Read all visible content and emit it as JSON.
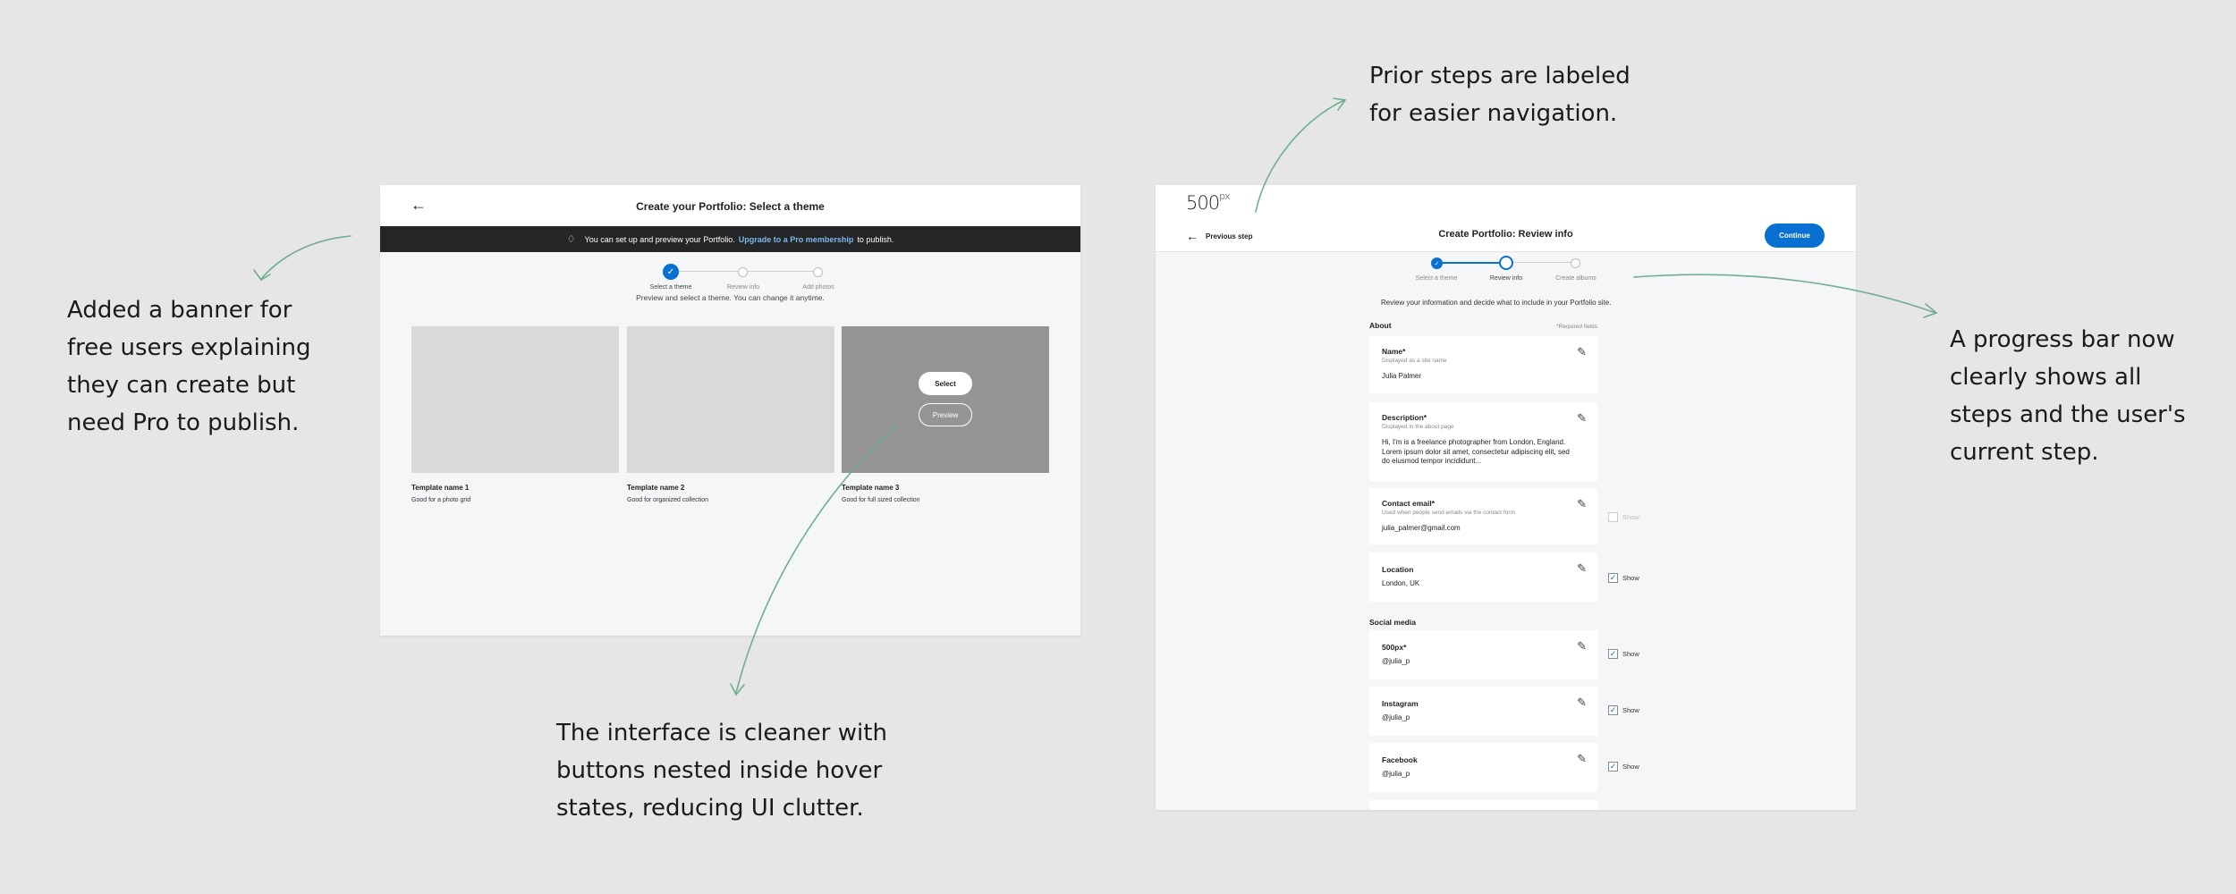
{
  "annotations": {
    "banner": [
      "Added a banner for",
      "free users explaining",
      "they can create but",
      "need Pro to publish."
    ],
    "hover": [
      "The interface is cleaner with",
      "buttons nested inside hover",
      "states, reducing UI clutter."
    ],
    "prior": [
      "Prior steps are labeled",
      "for easier navigation."
    ],
    "progress": [
      "A progress bar now",
      "clearly shows all",
      "steps and the user's",
      "current step."
    ]
  },
  "left_screen": {
    "back_icon": "arrow-left-icon",
    "title": "Create your Portfolio: Select a theme",
    "banner": {
      "icon": "diamond-icon",
      "text": "You can set up and preview your Portfolio.",
      "link": "Upgrade to a Pro membership",
      "suffix": "to publish."
    },
    "steps": [
      "Select a theme",
      "Review info",
      "Add photos"
    ],
    "subtitle": "Preview and select a theme. You can change it anytime.",
    "templates": [
      {
        "name": "Template name 1",
        "desc": "Good for a photo grid"
      },
      {
        "name": "Template name 2",
        "desc": "Good for organized collection"
      },
      {
        "name": "Template name 3",
        "desc": "Good for full sized collection"
      }
    ],
    "select_label": "Select",
    "preview_label": "Preview"
  },
  "right_screen": {
    "logo": "500",
    "logo_sup": "px",
    "prev_label": "Previous step",
    "title": "Create Portfolio: Review info",
    "continue_label": "Continue",
    "steps": [
      "Select a theme",
      "Review info",
      "Create albums"
    ],
    "intro": "Review your information and decide what to include in your Portfolio site.",
    "about_label": "About",
    "required_label": "*Required fields",
    "social_label": "Social media",
    "show_label": "Show",
    "cards": {
      "name": {
        "title": "Name*",
        "sub": "Displayed as a site name",
        "value": "Julia Palmer"
      },
      "description": {
        "title": "Description*",
        "sub": "Displayed in the about page",
        "value": "Hi, I'm is a freelance photographer from London, England. Lorem ipsum dolor sit amet, consectetur adipiscing elit, sed do eiusmod tempor incididunt..."
      },
      "email": {
        "title": "Contact email*",
        "sub": "Used when people send emails via the contact form",
        "value": "julia_palmer@gmail.com"
      },
      "location": {
        "title": "Location",
        "value": "London, UK"
      },
      "px500": {
        "title": "500px*",
        "value": "@julia_p"
      },
      "instagram": {
        "title": "Instagram",
        "value": "@julia_p"
      },
      "facebook": {
        "title": "Facebook",
        "value": "@julia_p"
      }
    },
    "colors": {
      "accent": "#0870d1",
      "banner_bg": "#232527",
      "link": "#7fb7ef"
    }
  }
}
